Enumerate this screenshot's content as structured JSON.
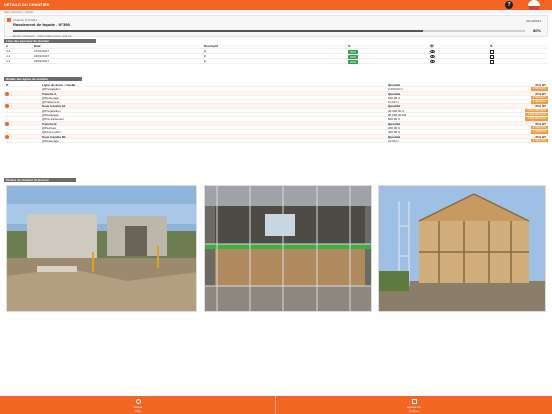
{
  "app": {
    "title": "DÉTAILS DU CHANTIER",
    "help_label": "?",
    "breadcrumb": "Mes chantiers › Détail"
  },
  "chantier": {
    "ref": "Chantier N°01234",
    "name": "Ravalement de façade - N°398",
    "date": "01/10/2024",
    "progress_label": "80%",
    "progress_value": 0.8,
    "client": "Berthon Roberto - Robert Entreprise and Co"
  },
  "journaux": {
    "section_title": "Liste des journaux de chantier",
    "headers": [
      "#",
      "Date",
      "Descriptif",
      "%",
      "👁",
      "✎"
    ],
    "rows": [
      {
        "id": "J-1",
        "date": "27/01/2017",
        "desc": "jh",
        "pct": "20%"
      },
      {
        "id": "J-1",
        "date": "24/01/2017",
        "desc": "jh",
        "pct": "20%"
      },
      {
        "id": "J-1",
        "date": "22/01/2017",
        "desc": "jh",
        "pct": "20%"
      }
    ]
  },
  "lignes": {
    "section_title": "Détails des lignes de chantier",
    "headers": [
      "Ligne du devis : Libellé",
      "Quantité",
      "Prix HT"
    ],
    "rows": [
      {
        "kind": "item",
        "label": "@Préparation",
        "qty": "2 000,00 U",
        "price": "1 500,00 €"
      },
      {
        "kind": "tranche",
        "label": "Tranche A",
        "qty": "Quantité",
        "price": "Prix HT"
      },
      {
        "kind": "item",
        "label": "@Nettoyage",
        "qty": "200,00 U",
        "price": "1 500,00 €"
      },
      {
        "kind": "item",
        "label": "@Traitement",
        "qty": "10,00 U",
        "price": "1 500,00 €"
      },
      {
        "kind": "tranche",
        "label": "Sous tranche A1",
        "qty": "Quantité",
        "price": "Prix HT"
      },
      {
        "kind": "item",
        "label": "@Préparation",
        "qty": "40 000,00 U",
        "price": "1 000 000,00 €"
      },
      {
        "kind": "item",
        "label": "@Décapage",
        "qty": "25 000,00 M2",
        "price": "1 000 000,00 €"
      },
      {
        "kind": "item",
        "label": "@Pré-traitement",
        "qty": "500,00 U",
        "price": "1 000 000,00 €"
      },
      {
        "kind": "tranche",
        "label": "Tranche B",
        "qty": "Quantité",
        "price": "Prix HT"
      },
      {
        "kind": "item",
        "label": "@Peinture",
        "qty": "200,00 U",
        "price": "1 500,00 €"
      },
      {
        "kind": "item",
        "label": "@Finie enduit",
        "qty": "400,00 U",
        "price": "1 500,00 €"
      },
      {
        "kind": "tranche",
        "label": "Sous tranche B1",
        "qty": "Quantité",
        "price": "Prix HT"
      },
      {
        "kind": "item",
        "label": "@Nettoyage",
        "qty": "10,00 U",
        "price": "1 500,00 €"
      }
    ]
  },
  "photos": {
    "section_title": "Photos du chantier (3 photos)",
    "items": [
      {
        "name": "photo-construction-site"
      },
      {
        "name": "photo-scaffolding-facade"
      },
      {
        "name": "photo-wooden-frame-house"
      }
    ]
  },
  "bottom": {
    "back_label": "Retour",
    "back_sub": "liste",
    "add_label": "Ajouter un",
    "add_sub": "journal"
  },
  "colors": {
    "accent": "#f26522",
    "success": "#2e9e4f",
    "tranche_pill": "#f39c3c"
  }
}
